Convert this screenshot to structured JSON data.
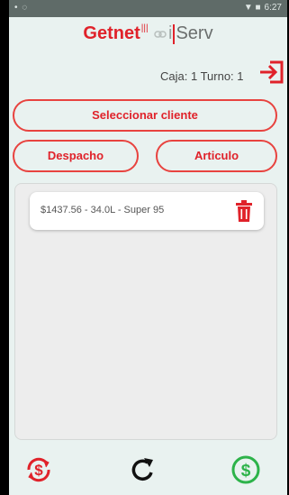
{
  "statusbar": {
    "left": "• ◌",
    "time": "6:27"
  },
  "logo": {
    "brand": "Getnet",
    "bars": "|||",
    "i": "i",
    "serv": "Serv"
  },
  "header": {
    "caja_turno": "Caja: 1 Turno: 1",
    "exit_icon": "exit-icon"
  },
  "buttons": {
    "seleccionar_cliente": "Seleccionar cliente",
    "despacho": "Despacho",
    "articulo": "Articulo"
  },
  "items": [
    {
      "text": "$1437.56 - 34.0L - Super 95",
      "icon": "trash-icon"
    }
  ],
  "bottom": {
    "icons": [
      "swap-dollar-icon",
      "refresh-icon",
      "pay-dollar-icon"
    ]
  },
  "colors": {
    "accent": "#e0222a",
    "green": "#2db34a",
    "background": "#e9f2f0"
  }
}
